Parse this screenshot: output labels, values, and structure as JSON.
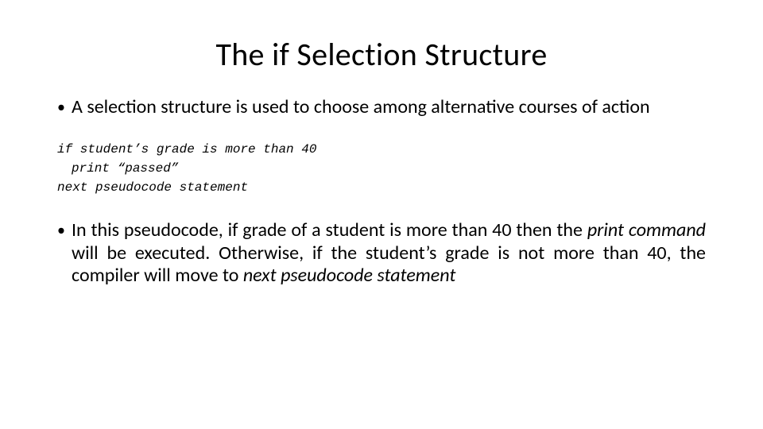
{
  "title": "The if Selection Structure",
  "bullets": {
    "b1": "A selection structure is used to choose among alternative courses of action",
    "b2_pre": "In this pseudocode, if grade of a student is more than 40 then the ",
    "b2_em1": "print command",
    "b2_mid": " will be executed. Otherwise, if the student’s grade is not more than 40, the compiler will move to ",
    "b2_em2": "next pseudocode statement"
  },
  "pseudocode": {
    "line1": "if student’s grade is more than 40",
    "line2": "print “passed”",
    "line3": "next pseudocode statement"
  }
}
